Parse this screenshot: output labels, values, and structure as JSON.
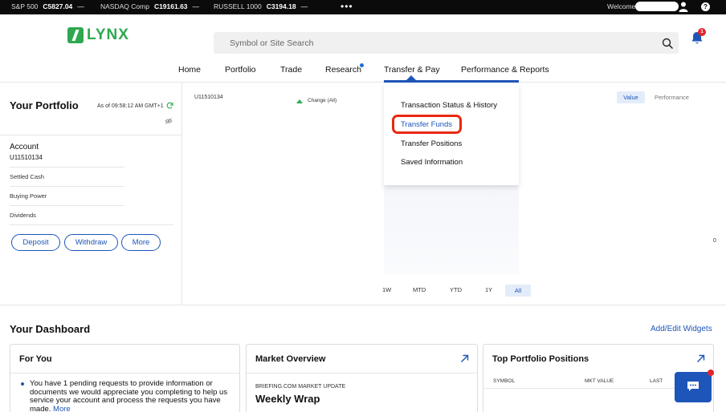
{
  "ticker": {
    "sp500": {
      "label": "S&P 500",
      "value": "C5827.04",
      "change": "—"
    },
    "nasdaq": {
      "label": "NASDAQ Comp",
      "value": "C19161.63",
      "change": "—"
    },
    "russell": {
      "label": "RUSSELL 1000",
      "value": "C3194.18",
      "change": "—"
    },
    "more": "•••",
    "welcome": "Welcome"
  },
  "header": {
    "logo_text": "LYNX",
    "search_placeholder": "Symbol or Site Search",
    "notification_count": "1"
  },
  "nav": {
    "home": "Home",
    "portfolio": "Portfolio",
    "trade": "Trade",
    "research": "Research",
    "transfer_pay": "Transfer & Pay",
    "performance": "Performance & Reports"
  },
  "dropdown": {
    "items": [
      "Transaction Status & History",
      "Transfer Funds",
      "Transfer Positions",
      "Saved Information"
    ]
  },
  "portfolio": {
    "title": "Your Portfolio",
    "as_of": "As of 09:58:12 AM GMT+1",
    "account_label": "Account",
    "account_id": "U11510134",
    "rows": [
      "Settled Cash",
      "Buying Power",
      "Dividends"
    ],
    "buttons": {
      "deposit": "Deposit",
      "withdraw": "Withdraw",
      "more": "More"
    }
  },
  "chart_panel": {
    "account": "U11510134",
    "change_label": "Change (All)",
    "toggle_value": "Value",
    "toggle_performance": "Performance",
    "edge_fragment": "0",
    "ranges": [
      "1W",
      "MTD",
      "YTD",
      "1Y",
      "All"
    ]
  },
  "dashboard": {
    "title": "Your Dashboard",
    "add_edit": "Add/Edit Widgets",
    "for_you": {
      "title": "For You",
      "text": "You have 1 pending requests to provide information or documents we would appreciate you completing to help us service your account and process the requests you have made.",
      "more": "More"
    },
    "market_overview": {
      "title": "Market Overview",
      "source": "BRIEFING.COM MARKET UPDATE",
      "headline": "Weekly Wrap"
    },
    "top_positions": {
      "title": "Top Portfolio Positions",
      "columns": [
        "SYMBOL",
        "MKT VALUE",
        "LAST"
      ]
    }
  },
  "colors": {
    "brand_green": "#2fa84f",
    "accent_blue": "#1e55b8",
    "highlight_red": "#e8280f"
  }
}
